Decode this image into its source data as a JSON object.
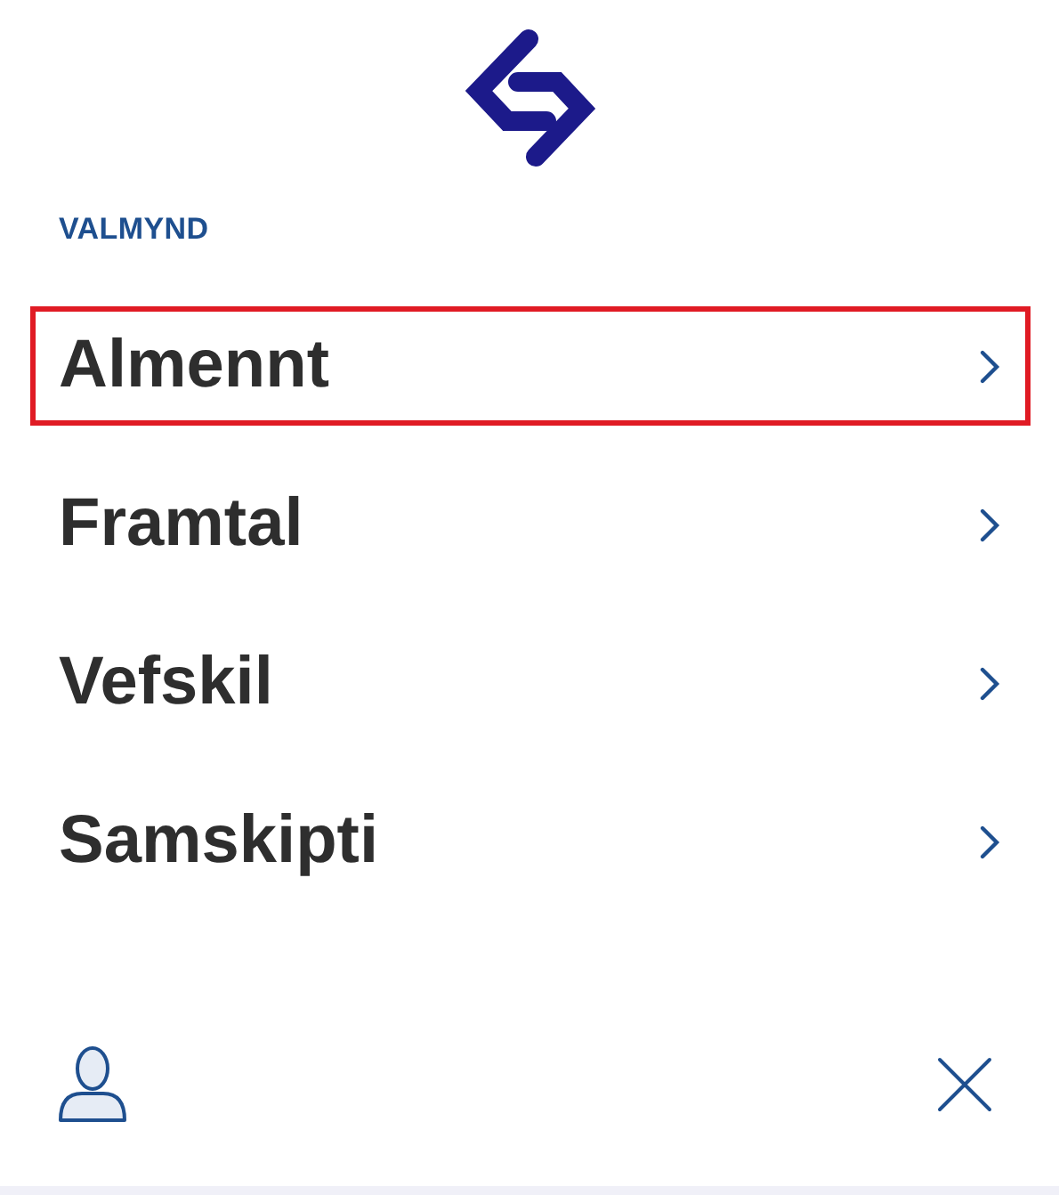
{
  "heading": "VALMYND",
  "menu_items": [
    {
      "label": "Almennt",
      "selected": true
    },
    {
      "label": "Framtal",
      "selected": false
    },
    {
      "label": "Vefskil",
      "selected": false
    },
    {
      "label": "Samskipti",
      "selected": false
    }
  ]
}
